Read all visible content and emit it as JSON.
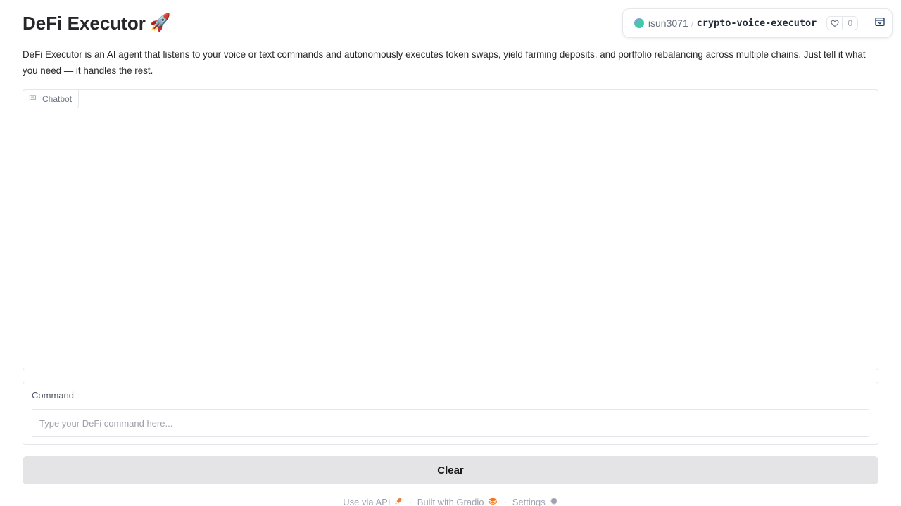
{
  "header": {
    "title": "DeFi Executor",
    "title_emoji": "🚀",
    "description": "DeFi Executor is an AI agent that listens to your voice or text commands and autonomously executes token swaps, yield farming deposits, and portfolio rebalancing across multiple chains. Just tell it what you need — it handles the rest."
  },
  "space_badge": {
    "owner": "isun3071",
    "separator": "/",
    "repo": "crypto-voice-executor",
    "likes": "0",
    "icons": {
      "like": "heart-icon",
      "expand": "collapse-panel-icon"
    }
  },
  "chatbot": {
    "label": "Chatbot",
    "icon": "chat-bubble-icon"
  },
  "command": {
    "label": "Command",
    "value": "",
    "placeholder": "Type your DeFi command here..."
  },
  "actions": {
    "clear_label": "Clear"
  },
  "footer": {
    "api_label": "Use via API",
    "api_emoji": "🚀",
    "built_label": "Built with Gradio",
    "settings_label": "Settings",
    "dot": "·",
    "icons": {
      "api": "rocket-icon",
      "gradio": "gradio-logo-icon",
      "settings": "gear-icon"
    }
  }
}
